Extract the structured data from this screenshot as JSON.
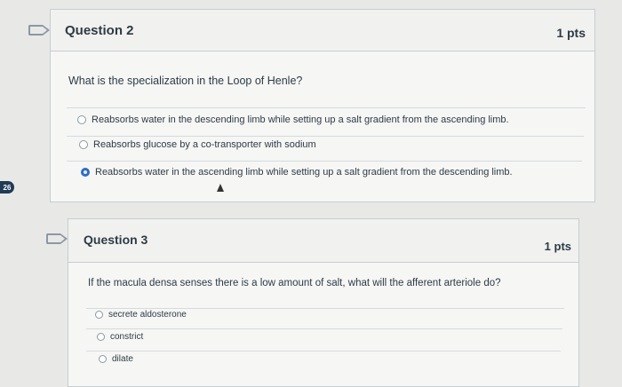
{
  "page_badge": "26",
  "questions": [
    {
      "title": "Question 2",
      "points": "1 pts",
      "text": "What is the specialization in the Loop of Henle?",
      "answers": [
        {
          "label": "Reabsorbs water in the descending limb while setting up a salt gradient from the ascending limb.",
          "selected": false
        },
        {
          "label": "Reabsorbs glucose by a co-transporter with sodium",
          "selected": false
        },
        {
          "label": "Reabsorbs water in the ascending limb while setting up a salt gradient from the descending limb.",
          "selected": true
        }
      ]
    },
    {
      "title": "Question 3",
      "points": "1 pts",
      "text": "If the macula densa senses there is a low amount of salt, what will the afferent arteriole do?",
      "answers": [
        {
          "label": "secrete aldosterone",
          "selected": false
        },
        {
          "label": "constrict",
          "selected": false
        },
        {
          "label": "dilate",
          "selected": false
        }
      ]
    }
  ],
  "colors": {
    "accent": "#2d6ec0",
    "text": "#2d3b45"
  }
}
